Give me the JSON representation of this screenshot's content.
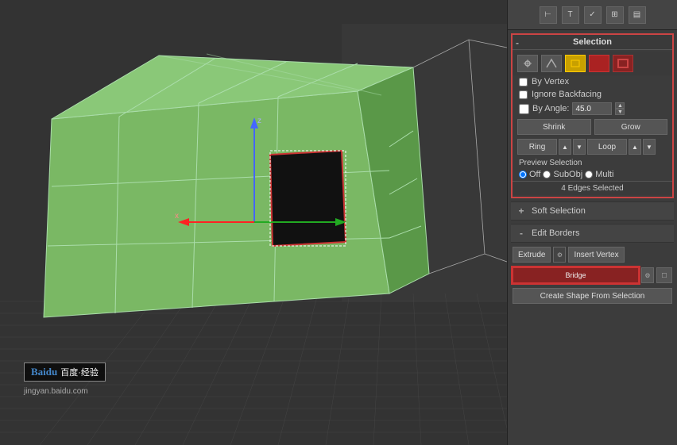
{
  "viewport": {
    "label": "3D Viewport"
  },
  "toolbar": {
    "icons": [
      "⊢",
      "T",
      "✓",
      "⊞",
      "▤"
    ]
  },
  "selection": {
    "title": "Selection",
    "icons": [
      {
        "id": "vertex-icon",
        "symbol": "·∨",
        "style": "normal"
      },
      {
        "id": "edge-icon",
        "symbol": "⌒",
        "style": "normal"
      },
      {
        "id": "face-icon",
        "symbol": "□",
        "style": "active-yellow"
      },
      {
        "id": "element-icon",
        "symbol": "■",
        "style": "active-red"
      },
      {
        "id": "border-icon",
        "symbol": "⊞",
        "style": "active-dark-red"
      }
    ],
    "by_vertex_label": "By Vertex",
    "ignore_backfacing_label": "Ignore Backfacing",
    "by_angle_label": "By Angle:",
    "by_angle_value": "45.0",
    "shrink_label": "Shrink",
    "grow_label": "Grow",
    "ring_label": "Ring",
    "loop_label": "Loop",
    "preview_selection_label": "Preview Selection",
    "radio_options": [
      "Off",
      "SubObj",
      "Multi"
    ],
    "status": "4 Edges Selected"
  },
  "soft_selection": {
    "label": "Soft Selection",
    "collapsed": false,
    "icon": "+"
  },
  "edit_borders": {
    "label": "Edit Borders",
    "collapsed": false,
    "icon": "-",
    "extrude_label": "Extrude",
    "insert_vertex_label": "Insert Vertex",
    "create_shape_label": "Create Shape From Selection"
  },
  "watermark": {
    "logo": "Baidu",
    "text": "百度·经验",
    "url": "jingyan.baidu.com"
  }
}
